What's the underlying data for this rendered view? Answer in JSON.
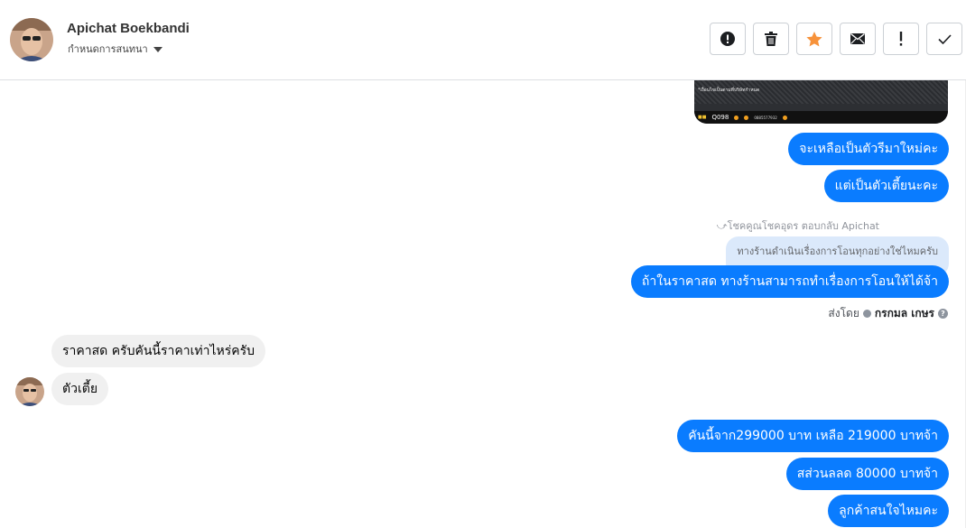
{
  "header": {
    "name": "Apichat Boekbandi",
    "assign_label": "กำหนดการสนทนา",
    "actions": [
      {
        "name": "spam-button",
        "icon": "alert-circle-icon"
      },
      {
        "name": "delete-button",
        "icon": "trash-icon"
      },
      {
        "name": "star-button",
        "icon": "star-icon"
      },
      {
        "name": "mark-unread-button",
        "icon": "envelope-icon"
      },
      {
        "name": "follow-up-button",
        "icon": "exclamation-icon"
      },
      {
        "name": "mark-done-button",
        "icon": "check-icon"
      }
    ]
  },
  "photo": {
    "caption": "*เงื่อนไขเป็นตามที่บริษัทกำหนด",
    "code": "Q098",
    "contact": "0885577932"
  },
  "messages": {
    "m1": "จะเหลือเป็นตัวรีมาใหม่คะ",
    "m2": "แต่เป็นตัวเตี้ยนะคะ",
    "reply_info": "โชคคูณโชคอุดร ตอบกลับ Apichat",
    "quoted": "ทางร้านดำเนินเรื่องการโอนทุกอย่างใช่ไหมครับ",
    "m3": "ถ้าในราคาสด ทางร้านสามารถทำเรื่องการโอนให้ได้จ้า",
    "sent_by_prefix": "ส่งโดย",
    "sent_by_name": "กรกมล เกษร",
    "in1": "ราคาสด ครับคันนี้ราคาเท่าไหร่ครับ",
    "in2": "ตัวเตี้ย",
    "m4": "คันนี้จาก299000 บาท เหลือ 219000 บาทจ้า",
    "m5": "สส่วนลลด 80000 บาทจ้า",
    "m6": "ลูกค้าสนใจไหมคะ"
  },
  "colors": {
    "outgoing": "#0a7cff",
    "incoming": "#f0f0f0",
    "star": "#f7923a"
  }
}
